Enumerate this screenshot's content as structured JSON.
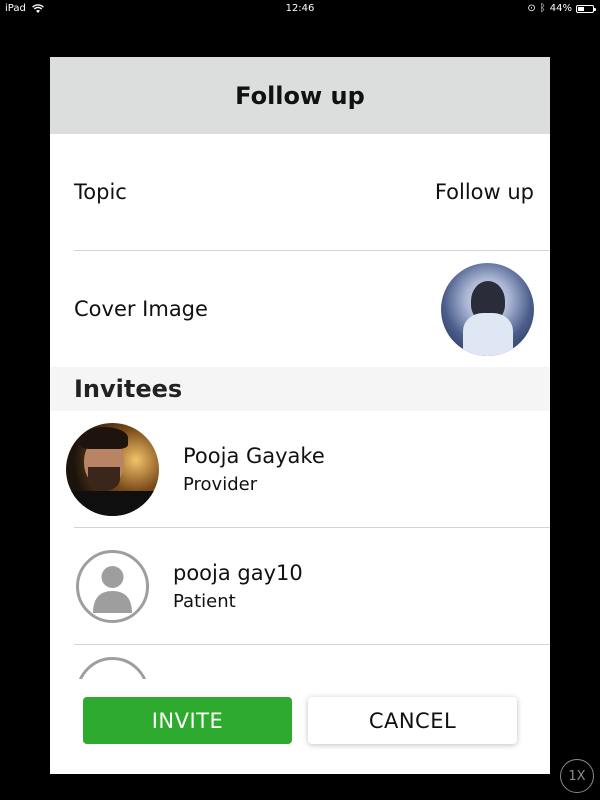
{
  "status_bar": {
    "device": "iPad",
    "time": "12:46",
    "battery_percent": "44%",
    "battery_level": 0.44
  },
  "modal": {
    "title": "Follow up",
    "topic": {
      "label": "Topic",
      "value": "Follow up"
    },
    "cover_image": {
      "label": "Cover Image"
    },
    "invitees_header": "Invitees",
    "invitees": [
      {
        "name": "Pooja Gayake",
        "role": "Provider",
        "avatar": "photo"
      },
      {
        "name": "pooja gay10",
        "role": "Patient",
        "avatar": "placeholder"
      }
    ],
    "buttons": {
      "invite": "INVITE",
      "cancel": "CANCEL"
    },
    "colors": {
      "header_bg": "#dcdedd",
      "invite_bg": "#2eaa2e"
    }
  },
  "zoom": {
    "label": "1X"
  }
}
